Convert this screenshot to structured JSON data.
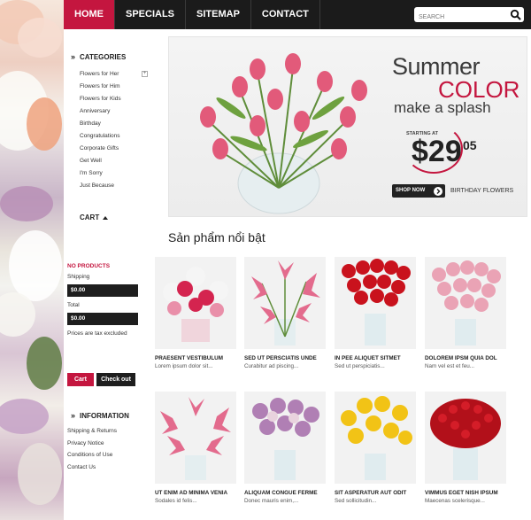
{
  "nav": {
    "items": [
      "HOME",
      "SPECIALS",
      "SITEMAP",
      "CONTACT"
    ],
    "search_placeholder": "SEARCH"
  },
  "sidebar": {
    "categories_title": "CATEGORIES",
    "categories": [
      "Flowers for Her",
      "Flowers for Him",
      "Flowers for Kids",
      "Anniversary",
      "Birthday",
      "Congratulations",
      "Corporate Gifts",
      "Get Well",
      "I'm Sorry",
      "Just Because"
    ],
    "expand_symbol": "+",
    "cart_title": "CART",
    "cart": {
      "no_products": "NO PRODUCTS",
      "shipping_label": "Shipping",
      "shipping_value": "$0.00",
      "total_label": "Total",
      "total_value": "$0.00",
      "note": "Prices are tax excluded",
      "cart_button": "Cart",
      "checkout_button": "Check out"
    },
    "information_title": "INFORMATION",
    "information": [
      "Shipping & Returns",
      "Privacy Notice",
      "Conditions of Use",
      "Contact Us"
    ]
  },
  "banner": {
    "line1": "Summer",
    "line2": "COLOR",
    "line3": "make a splash",
    "starting_at": "STARTING AT",
    "price_main": "$29",
    "price_cents": "05",
    "shop_now": "SHOP NOW",
    "caption": "BIRTHDAY FLOWERS"
  },
  "featured": {
    "title": "Sản phẩm nổi bật",
    "products": [
      {
        "name": "PRAESENT VESTIBULUM",
        "desc": "Lorem ipsum dolor sit..."
      },
      {
        "name": "SED UT PERSCIATIS UNDE",
        "desc": "Curabitur ad piscing..."
      },
      {
        "name": "IN PEE ALIQUET SITMET",
        "desc": "Sed ut perspiciatis..."
      },
      {
        "name": "DOLOREM IPSM QUIA DOL",
        "desc": "Nam vel est et feu..."
      },
      {
        "name": "UT ENIM AD MINIMA VENIA",
        "desc": "Sodales id felis..."
      },
      {
        "name": "ALIQUAM CONGUE FERME",
        "desc": "Donec mauris enim,..."
      },
      {
        "name": "SIT ASPERATUR AUT ODIT",
        "desc": "Sed sollicitudin..."
      },
      {
        "name": "VIMMUS EGET NISH IPSUM",
        "desc": "Maecenas scelerisque..."
      }
    ]
  },
  "colors": {
    "accent": "#c4163f",
    "nav_bg": "#1b1b1b"
  }
}
